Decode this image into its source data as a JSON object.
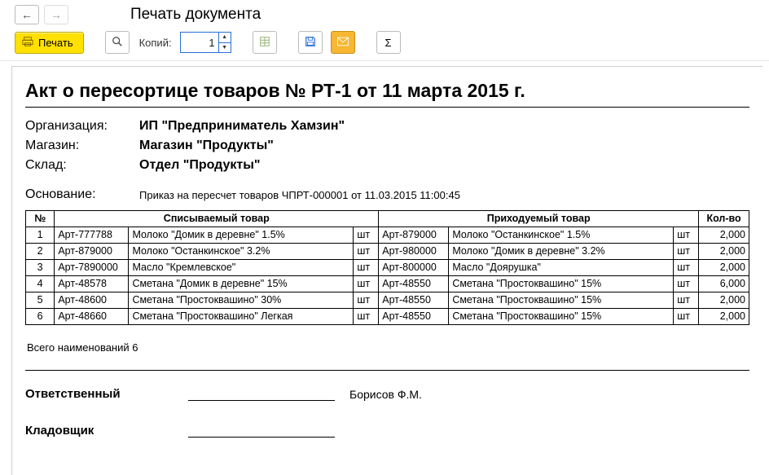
{
  "header": {
    "window_title": "Печать документа"
  },
  "toolbar": {
    "print_label": "Печать",
    "copies_label": "Копий:",
    "copies_value": "1"
  },
  "doc": {
    "title": "Акт о пересортице товаров № РТ-1 от 11 марта 2015 г.",
    "org_label": "Организация:",
    "org_value": "ИП \"Предприниматель Хамзин\"",
    "store_label": "Магазин:",
    "store_value": "Магазин \"Продукты\"",
    "warehouse_label": "Склад:",
    "warehouse_value": "Отдел \"Продукты\"",
    "basis_label": "Основание:",
    "basis_value": "Приказ на пересчет товаров ЧПРТ-000001 от 11.03.2015 11:00:45"
  },
  "table": {
    "head": {
      "num": "№",
      "out": "Списываемый товар",
      "in": "Приходуемый товар",
      "qty": "Кол-во"
    },
    "rows": [
      {
        "n": "1",
        "out_art": "Арт-777788",
        "out_name": "Молоко \"Домик в деревне\" 1.5%",
        "out_unit": "шт",
        "in_art": "Арт-879000",
        "in_name": "Молоко \"Останкинское\" 1.5%",
        "in_unit": "шт",
        "qty": "2,000"
      },
      {
        "n": "2",
        "out_art": "Арт-879000",
        "out_name": "Молоко \"Останкинское\" 3.2%",
        "out_unit": "шт",
        "in_art": "Арт-980000",
        "in_name": "Молоко \"Домик в деревне\" 3.2%",
        "in_unit": "шт",
        "qty": "2,000"
      },
      {
        "n": "3",
        "out_art": "Арт-7890000",
        "out_name": "Масло \"Кремлевское\"",
        "out_unit": "шт",
        "in_art": "Арт-800000",
        "in_name": "Масло \"Доярушка\"",
        "in_unit": "шт",
        "qty": "2,000"
      },
      {
        "n": "4",
        "out_art": "Арт-48578",
        "out_name": "Сметана \"Домик в деревне\" 15%",
        "out_unit": "шт",
        "in_art": "Арт-48550",
        "in_name": "Сметана \"Простоквашино\" 15%",
        "in_unit": "шт",
        "qty": "6,000"
      },
      {
        "n": "5",
        "out_art": "Арт-48600",
        "out_name": "Сметана \"Простоквашино\" 30%",
        "out_unit": "шт",
        "in_art": "Арт-48550",
        "in_name": "Сметана \"Простоквашино\" 15%",
        "in_unit": "шт",
        "qty": "2,000"
      },
      {
        "n": "6",
        "out_art": "Арт-48660",
        "out_name": "Сметана \"Простоквашино\" Легкая",
        "out_unit": "шт",
        "in_art": "Арт-48550",
        "in_name": "Сметана \"Простоквашино\" 15%",
        "in_unit": "шт",
        "qty": "2,000"
      }
    ],
    "summary": "Всего наименований 6"
  },
  "signatures": {
    "responsible_label": "Ответственный",
    "responsible_name": "Борисов Ф.М.",
    "storekeeper_label": "Кладовщик",
    "storekeeper_name": ""
  }
}
